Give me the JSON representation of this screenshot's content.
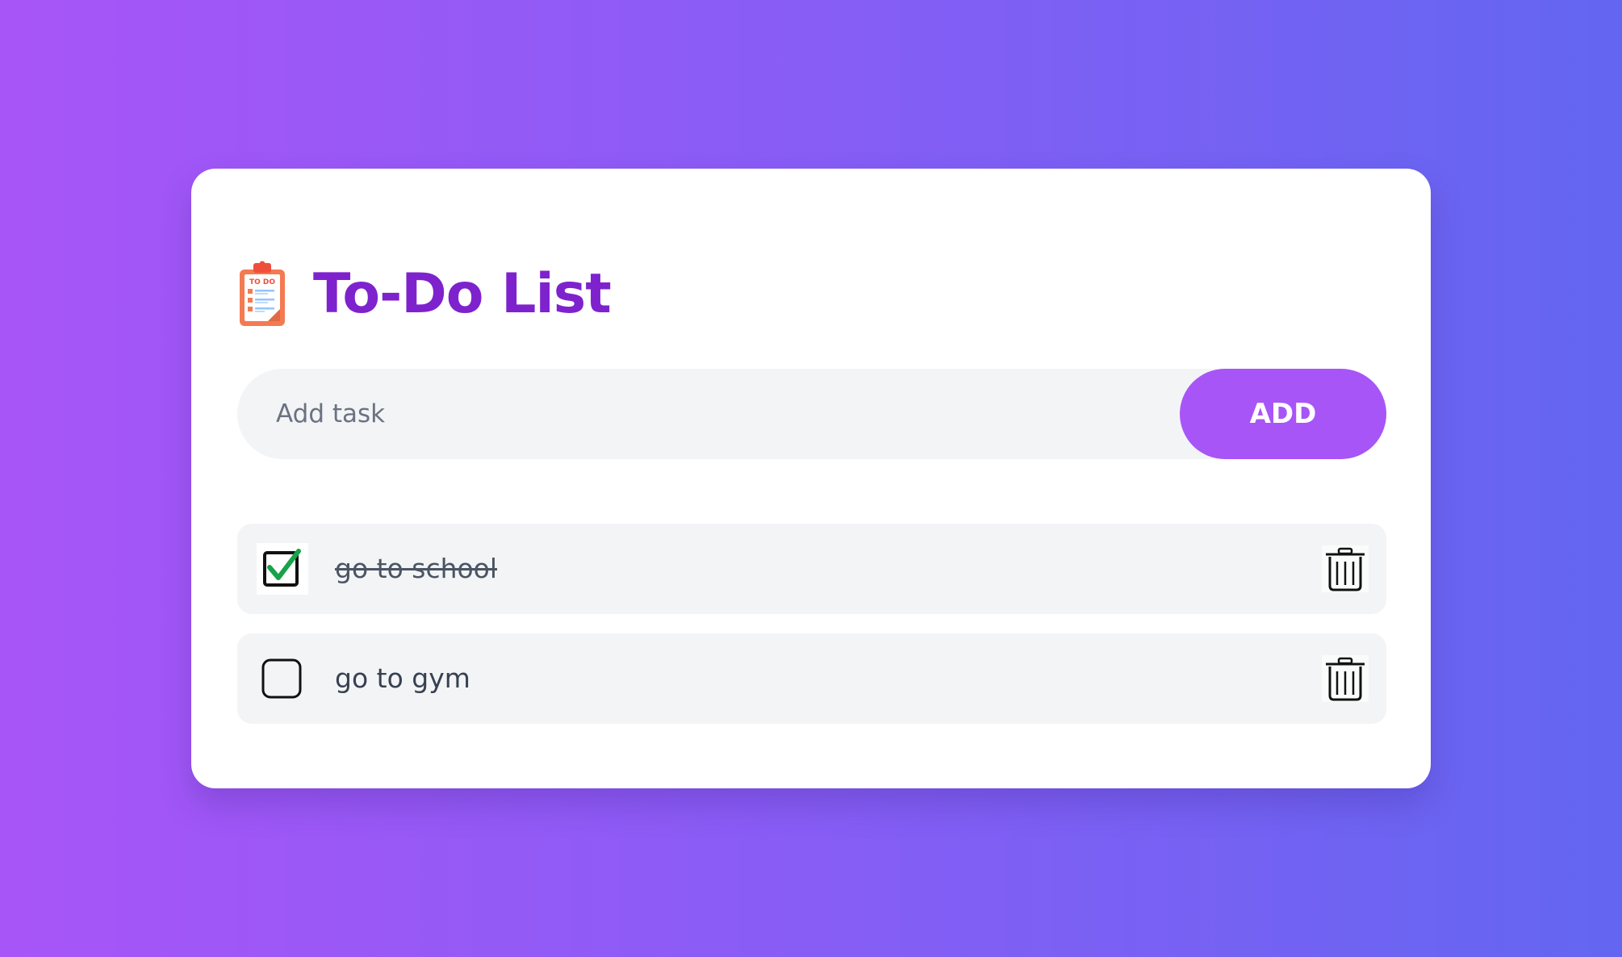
{
  "app": {
    "title": "To-Do List",
    "title_icon": "clipboard-todo-icon",
    "logo_text": "TO DO"
  },
  "add_task": {
    "placeholder": "Add task",
    "value": "",
    "button_label": "ADD"
  },
  "tasks": [
    {
      "text": "go to school",
      "checked": true,
      "check_icon": "checkbox-checked-icon",
      "delete_icon": "trash-icon"
    },
    {
      "text": "go to gym",
      "checked": false,
      "check_icon": "checkbox-unchecked-icon",
      "delete_icon": "trash-icon"
    }
  ],
  "colors": {
    "background_start": "#a855f7",
    "background_end": "#6366f1",
    "accent": "#a855f7",
    "title": "#7e22ce",
    "check_green": "#16a34a"
  }
}
